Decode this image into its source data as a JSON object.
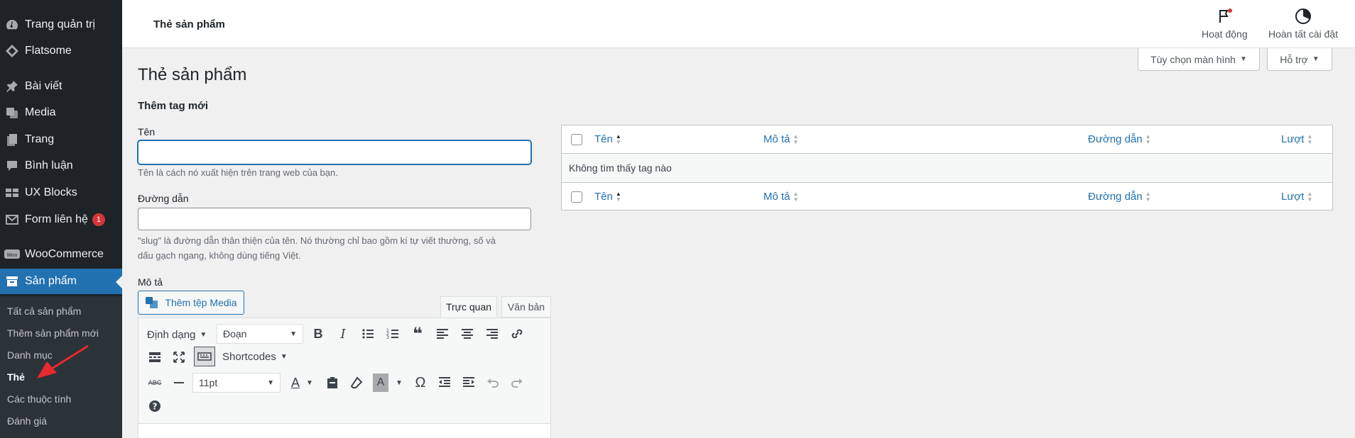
{
  "sidebar": {
    "items": [
      {
        "label": "Trang quản trị",
        "icon": "dashboard-icon"
      },
      {
        "label": "Flatsome",
        "icon": "flatsome-icon"
      },
      {
        "label": "Bài viết",
        "icon": "pin-icon"
      },
      {
        "label": "Media",
        "icon": "media-icon"
      },
      {
        "label": "Trang",
        "icon": "page-icon"
      },
      {
        "label": "Bình luận",
        "icon": "comment-icon"
      },
      {
        "label": "UX Blocks",
        "icon": "blocks-icon"
      },
      {
        "label": "Form liên hệ",
        "icon": "mail-icon",
        "badge": "1"
      },
      {
        "label": "WooCommerce",
        "icon": "woo-icon"
      },
      {
        "label": "Sản phẩm",
        "icon": "archive-icon"
      }
    ],
    "submenu": [
      "Tất cả sản phẩm",
      "Thêm sản phẩm mới",
      "Danh mục",
      "Thẻ",
      "Các thuộc tính",
      "Đánh giá"
    ]
  },
  "topbar": {
    "title": "Thẻ sản phẩm",
    "activity": "Hoạt động",
    "setup": "Hoàn tất cài đặt"
  },
  "screen_options": "Tùy chọn màn hình",
  "help": "Hỗ trợ",
  "page": {
    "heading": "Thẻ sản phẩm",
    "add_heading": "Thêm tag mới"
  },
  "form": {
    "name_label": "Tên",
    "name_value": "",
    "name_help": "Tên là cách nó xuất hiện trên trang web của bạn.",
    "slug_label": "Đường dẫn",
    "slug_value": "",
    "slug_help_1": "\"slug\" là đường dẫn thân thiện của tên. Nó thường chỉ bao gồm kí tự viết thường, số và",
    "slug_help_2": "dấu gạch ngang, không dùng tiếng Việt.",
    "desc_label": "Mô tả"
  },
  "editor": {
    "media_button": "Thêm tệp Media",
    "tab_visual": "Trực quan",
    "tab_text": "Văn bản",
    "format_label": "Định dạng",
    "paragraph": "Đoạn",
    "shortcodes": "Shortcodes",
    "font_size": "11pt"
  },
  "table": {
    "col_name": "Tên",
    "col_desc": "Mô tả",
    "col_slug": "Đường dẫn",
    "col_count": "Lượt",
    "empty": "Không tìm thấy tag nào"
  },
  "colors": {
    "accent": "#2271b1",
    "sidebar_bg": "#1d2327",
    "badge": "#d63638",
    "arrow": "#e8282c"
  }
}
